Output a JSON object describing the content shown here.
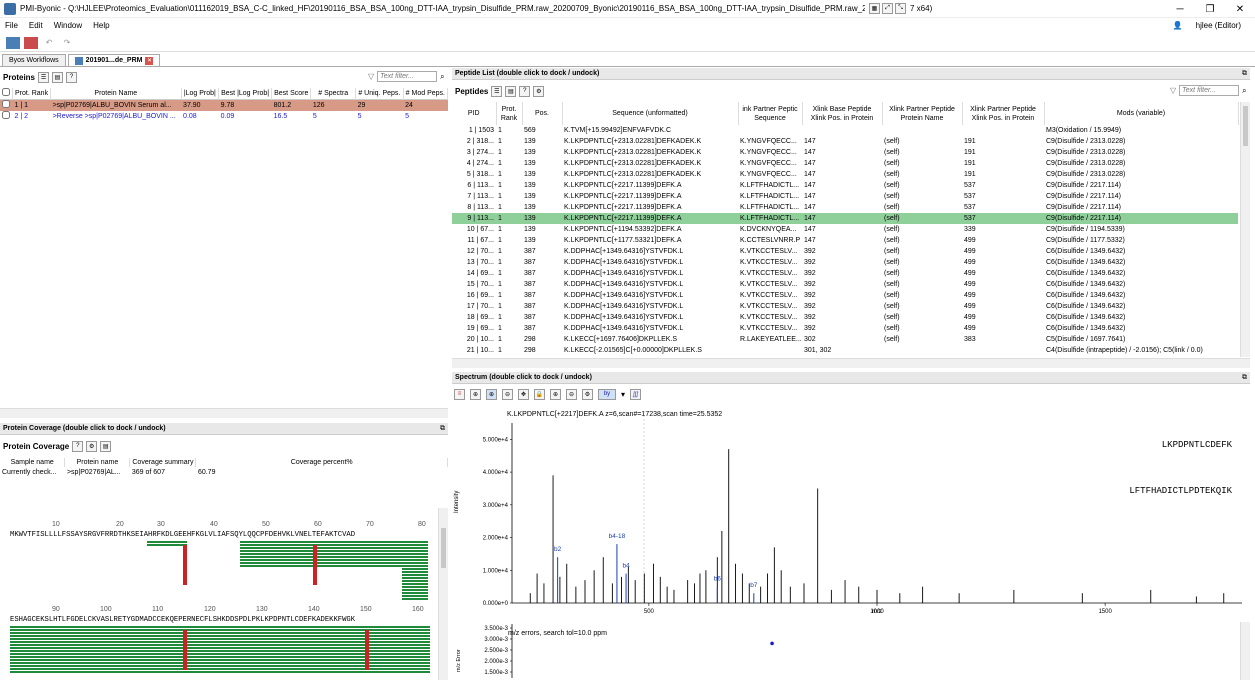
{
  "window": {
    "title": "PMI-Byonic - Q:\\HJLEE\\Proteomics_Evaluation\\011162019_BSA_C-C_linked_HF\\20190116_BSA_BSA_100ng_DTT-IAA_trypsin_Disulfide_PRM.raw_20200709_Byonic\\20190116_BSA_BSA_100ng_DTT-IAA_trypsin_Disulfide_PRM.raw_20200709_Byonic",
    "arch": "7 x64)"
  },
  "menu": [
    "File",
    "Edit",
    "Window",
    "Help"
  ],
  "user": "hjlee (Editor)",
  "tabs": [
    {
      "label": "Byos Workflows"
    },
    {
      "label": "201901...de_PRM"
    }
  ],
  "proteins": {
    "heading": "Proteins",
    "filter_placeholder": "Text filter...",
    "columns": [
      "Prot. Rank",
      "Protein Name",
      "|Log Prob|",
      "Best |Log Prob|",
      "Best Score",
      "# Spectra",
      "# Uniq. Peps.",
      "# Mod Peps."
    ],
    "rows": [
      {
        "rank": "1 | 1",
        "name": ">sp|P02769|ALBU_BOVIN Serum al...",
        "logprob": "37.90",
        "best_logprob": "9.78",
        "best_score": "801.2",
        "spectra": "126",
        "uniq": "29",
        "mod": "24"
      },
      {
        "rank": "2 | 2",
        "name": ">Reverse >sp|P02769|ALBU_BOVIN ...",
        "logprob": "0.08",
        "best_logprob": "0.09",
        "best_score": "16.5",
        "spectra": "5",
        "uniq": "5",
        "mod": "5"
      }
    ]
  },
  "peptides": {
    "panel_title": "Peptide List (double click to dock / undock)",
    "heading": "Peptides",
    "filter_placeholder": "Text filter...",
    "columns": [
      "PID",
      "Prot. Rank",
      "Pos.",
      "Sequence (unformatted)",
      "ink Partner Peptic Sequence",
      "Xlink Base Peptide Xlink Pos. in Protein",
      "Xlink Partner Peptide Protein Name",
      "Xlink Partner Peptide Xlink Pos. in Protein",
      "Mods (variable)"
    ],
    "rows": [
      [
        "1 | 1503",
        "1",
        "569",
        "K.TVM[+15.99492]ENFVAFVDK.C",
        "",
        "",
        "",
        "",
        "M3(Oxidation / 15.9949)"
      ],
      [
        "2 | 318...",
        "1",
        "139",
        "K.LKPDPNTLC[+2313.02281]DEFKADEK.K",
        "K.YNGVFQECC...",
        "147",
        "(self)",
        "191",
        "C9(Disulfide / 2313.0228)"
      ],
      [
        "3 | 274...",
        "1",
        "139",
        "K.LKPDPNTLC[+2313.02281]DEFKADEK.K",
        "K.YNGVFQECC...",
        "147",
        "(self)",
        "191",
        "C9(Disulfide / 2313.0228)"
      ],
      [
        "4 | 274...",
        "1",
        "139",
        "K.LKPDPNTLC[+2313.02281]DEFKADEK.K",
        "K.YNGVFQECC...",
        "147",
        "(self)",
        "191",
        "C9(Disulfide / 2313.0228)"
      ],
      [
        "5 | 318...",
        "1",
        "139",
        "K.LKPDPNTLC[+2313.02281]DEFKADEK.K",
        "K.YNGVFQECC...",
        "147",
        "(self)",
        "191",
        "C9(Disulfide / 2313.0228)"
      ],
      [
        "6 | 113...",
        "1",
        "139",
        "K.LKPDPNTLC[+2217.11399]DEFK.A",
        "K.LFTFHADICTL...",
        "147",
        "(self)",
        "537",
        "C9(Disulfide / 2217.114)"
      ],
      [
        "7 | 113...",
        "1",
        "139",
        "K.LKPDPNTLC[+2217.11399]DEFK.A",
        "K.LFTFHADICTL...",
        "147",
        "(self)",
        "537",
        "C9(Disulfide / 2217.114)"
      ],
      [
        "8 | 113...",
        "1",
        "139",
        "K.LKPDPNTLC[+2217.11399]DEFK.A",
        "K.LFTFHADICTL...",
        "147",
        "(self)",
        "537",
        "C9(Disulfide / 2217.114)"
      ],
      [
        "9 | 113...",
        "1",
        "139",
        "K.LKPDPNTLC[+2217.11399]DEFK.A",
        "K.LFTFHADICTL...",
        "147",
        "(self)",
        "537",
        "C9(Disulfide / 2217.114)"
      ],
      [
        "10 | 67...",
        "1",
        "139",
        "K.LKPDPNTLC[+1194.53392]DEFK.A",
        "K.DVCKNYQEA...",
        "147",
        "(self)",
        "339",
        "C9(Disulfide / 1194.5339)"
      ],
      [
        "11 | 67...",
        "1",
        "139",
        "K.LKPDPNTLC[+1177.53321]DEFK.A",
        "K.CCTESLVNRR.P",
        "147",
        "(self)",
        "499",
        "C9(Disulfide / 1177.5332)"
      ],
      [
        "12 | 70...",
        "1",
        "387",
        "K.DDPHAC[+1349.64316]YSTVFDK.L",
        "K.VTKCCTESLV...",
        "392",
        "(self)",
        "499",
        "C6(Disulfide / 1349.6432)"
      ],
      [
        "13 | 70...",
        "1",
        "387",
        "K.DDPHAC[+1349.64316]YSTVFDK.L",
        "K.VTKCCTESLV...",
        "392",
        "(self)",
        "499",
        "C6(Disulfide / 1349.6432)"
      ],
      [
        "14 | 69...",
        "1",
        "387",
        "K.DDPHAC[+1349.64316]YSTVFDK.L",
        "K.VTKCCTESLV...",
        "392",
        "(self)",
        "499",
        "C6(Disulfide / 1349.6432)"
      ],
      [
        "15 | 70...",
        "1",
        "387",
        "K.DDPHAC[+1349.64316]YSTVFDK.L",
        "K.VTKCCTESLV...",
        "392",
        "(self)",
        "499",
        "C6(Disulfide / 1349.6432)"
      ],
      [
        "16 | 69...",
        "1",
        "387",
        "K.DDPHAC[+1349.64316]YSTVFDK.L",
        "K.VTKCCTESLV...",
        "392",
        "(self)",
        "499",
        "C6(Disulfide / 1349.6432)"
      ],
      [
        "17 | 70...",
        "1",
        "387",
        "K.DDPHAC[+1349.64316]YSTVFDK.L",
        "K.VTKCCTESLV...",
        "392",
        "(self)",
        "499",
        "C6(Disulfide / 1349.6432)"
      ],
      [
        "18 | 69...",
        "1",
        "387",
        "K.DDPHAC[+1349.64316]YSTVFDK.L",
        "K.VTKCCTESLV...",
        "392",
        "(self)",
        "499",
        "C6(Disulfide / 1349.6432)"
      ],
      [
        "19 | 69...",
        "1",
        "387",
        "K.DDPHAC[+1349.64316]YSTVFDK.L",
        "K.VTKCCTESLV...",
        "392",
        "(self)",
        "499",
        "C6(Disulfide / 1349.6432)"
      ],
      [
        "20 | 10...",
        "1",
        "298",
        "K.LKECC[+1697.76406]DKPLLEK.S",
        "R.LAKEYEATLEE...",
        "302",
        "(self)",
        "383",
        "C5(Disulfide / 1697.7641)"
      ],
      [
        "21 | 10...",
        "1",
        "298",
        "K.LKECC[-2.01565]C[+0.00000]DKPLLEK.S",
        "",
        "301, 302",
        "",
        "",
        "C4(Disulfide (intrapeptide) / -2.0156); C5(link / 0.0)"
      ]
    ],
    "selected_row": 8
  },
  "coverage": {
    "panel_title": "Protein Coverage (double click to dock / undock)",
    "heading": "Protein Coverage",
    "columns": [
      "Sample name",
      "Protein name",
      "Coverage summary",
      "Coverage percent%"
    ],
    "row": [
      "Currently check...",
      ">sp|P02769|AL...",
      "369 of 607",
      "60.79"
    ],
    "line1_ticks": [
      "10",
      "20",
      "30",
      "40",
      "50",
      "60",
      "70",
      "80"
    ],
    "line1_seq": "MKWVTFISLLLLFSSAYSRGVFRRDTHKSEIAHRFKDLGEEHFKGLVLIAFSQYLQQCPFDEHVKLVNELTEFAKTCVAD",
    "line2_ticks": [
      "90",
      "100",
      "110",
      "120",
      "130",
      "140",
      "150",
      "160"
    ],
    "line2_seq": "ESHAGCEKSLHTLFGDELCKVASLRETYGDMADCCEKQEPERNECFLSHKDDSPDLPKLKPDPNTLCDEFKADEKKFWGK"
  },
  "spectrum": {
    "panel_title": "Spectrum (double click to dock / undock)",
    "annotation": "K.LKPDPNTLC[+2217]DEFK.A z=6,scan#=17238,scan time=25.5352",
    "peptide1": "LKPDPNTLCDEFK",
    "peptide2": "LFTFHADICTLPDTEKQIK",
    "ion_labels": [
      "b2",
      "b4-18",
      "b4",
      "b6",
      "b7"
    ],
    "error_label": "m/z errors, search tol=10.0 ppm",
    "x_axis_label": "m/z",
    "y_axis_label": "Intensity",
    "err_axis_label": "m/z Error",
    "err_ticks": [
      "3.500e-3",
      "3.000e-3",
      "2.500e-3",
      "2.000e-3",
      "1.500e-3"
    ],
    "chart_data": {
      "type": "bar",
      "xlabel": "m/z",
      "ylabel": "Intensity",
      "x_ticks": [
        500,
        1000,
        1500
      ],
      "y_ticks": [
        "0.000e+0",
        "1.000e+4",
        "2.000e+4",
        "3.000e+4",
        "4.000e+4",
        "5.000e+4"
      ],
      "xlim": [
        200,
        1800
      ],
      "ylim": [
        0,
        55000
      ],
      "peaks": [
        {
          "mz": 240,
          "i": 3000
        },
        {
          "mz": 255,
          "i": 9000
        },
        {
          "mz": 270,
          "i": 6000
        },
        {
          "mz": 290,
          "i": 39000
        },
        {
          "mz": 305,
          "i": 8000
        },
        {
          "mz": 320,
          "i": 12000
        },
        {
          "mz": 340,
          "i": 5000
        },
        {
          "mz": 360,
          "i": 7000
        },
        {
          "mz": 380,
          "i": 10000
        },
        {
          "mz": 400,
          "i": 14000
        },
        {
          "mz": 420,
          "i": 6000
        },
        {
          "mz": 440,
          "i": 8000
        },
        {
          "mz": 455,
          "i": 11000
        },
        {
          "mz": 470,
          "i": 7000
        },
        {
          "mz": 490,
          "i": 9000
        },
        {
          "mz": 510,
          "i": 12000
        },
        {
          "mz": 525,
          "i": 8000
        },
        {
          "mz": 540,
          "i": 5000
        },
        {
          "mz": 555,
          "i": 4000
        },
        {
          "mz": 585,
          "i": 7000
        },
        {
          "mz": 600,
          "i": 6000
        },
        {
          "mz": 612,
          "i": 9000
        },
        {
          "mz": 625,
          "i": 10000
        },
        {
          "mz": 650,
          "i": 14000
        },
        {
          "mz": 660,
          "i": 22000
        },
        {
          "mz": 675,
          "i": 47000
        },
        {
          "mz": 690,
          "i": 12000
        },
        {
          "mz": 705,
          "i": 9000
        },
        {
          "mz": 720,
          "i": 6000
        },
        {
          "mz": 745,
          "i": 5000
        },
        {
          "mz": 760,
          "i": 9000
        },
        {
          "mz": 775,
          "i": 17000
        },
        {
          "mz": 790,
          "i": 10000
        },
        {
          "mz": 810,
          "i": 5000
        },
        {
          "mz": 840,
          "i": 6000
        },
        {
          "mz": 870,
          "i": 35000
        },
        {
          "mz": 900,
          "i": 4000
        },
        {
          "mz": 930,
          "i": 7000
        },
        {
          "mz": 960,
          "i": 5000
        },
        {
          "mz": 1000,
          "i": 4000
        },
        {
          "mz": 1050,
          "i": 3000
        },
        {
          "mz": 1100,
          "i": 5000
        },
        {
          "mz": 1180,
          "i": 3000
        },
        {
          "mz": 1300,
          "i": 4000
        },
        {
          "mz": 1450,
          "i": 3000
        },
        {
          "mz": 1600,
          "i": 4000
        },
        {
          "mz": 1700,
          "i": 2000
        },
        {
          "mz": 1760,
          "i": 3000
        }
      ],
      "ion_marks": [
        {
          "label": "b2",
          "mz": 300,
          "i": 14000
        },
        {
          "label": "b4-18",
          "mz": 430,
          "i": 18000
        },
        {
          "label": "b4",
          "mz": 450,
          "i": 9000
        },
        {
          "label": "b6",
          "mz": 650,
          "i": 5000
        },
        {
          "label": "b7",
          "mz": 730,
          "i": 3000
        }
      ],
      "error_points": [
        {
          "mz": 770,
          "err": 0.0028
        }
      ]
    }
  }
}
